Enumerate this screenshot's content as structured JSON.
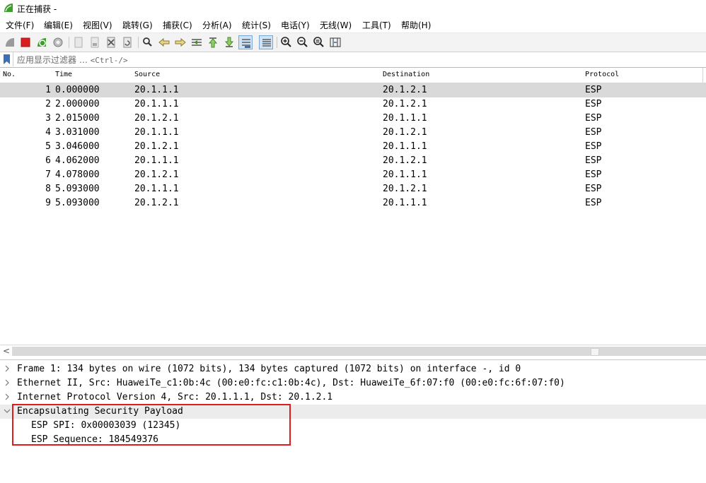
{
  "window": {
    "title": "正在捕获 -"
  },
  "menu": {
    "items": [
      {
        "label": "文件(F)"
      },
      {
        "label": "编辑(E)"
      },
      {
        "label": "视图(V)"
      },
      {
        "label": "跳转(G)"
      },
      {
        "label": "捕获(C)"
      },
      {
        "label": "分析(A)"
      },
      {
        "label": "统计(S)"
      },
      {
        "label": "电话(Y)"
      },
      {
        "label": "无线(W)"
      },
      {
        "label": "工具(T)"
      },
      {
        "label": "帮助(H)"
      }
    ]
  },
  "toolbar": {
    "buttons": [
      "start-capture-icon",
      "stop-capture-icon",
      "restart-capture-icon",
      "capture-options-icon",
      "open-file-icon",
      "save-file-icon",
      "close-file-icon",
      "reload-file-icon",
      "find-packet-icon",
      "go-back-icon",
      "go-forward-icon",
      "go-to-packet-icon",
      "go-first-icon",
      "go-last-icon",
      "autoscroll-icon",
      "colorize-icon",
      "zoom-in-icon",
      "zoom-out-icon",
      "zoom-normal-icon",
      "resize-columns-icon"
    ]
  },
  "filter": {
    "placeholder": "应用显示过滤器 …",
    "shortcut": "<Ctrl-/>"
  },
  "packet_list": {
    "columns": [
      "No.",
      "Time",
      "Source",
      "Destination",
      "Protocol"
    ],
    "rows": [
      {
        "no": "1",
        "time": "0.000000",
        "source": "20.1.1.1",
        "destination": "20.1.2.1",
        "protocol": "ESP"
      },
      {
        "no": "2",
        "time": "2.000000",
        "source": "20.1.1.1",
        "destination": "20.1.2.1",
        "protocol": "ESP"
      },
      {
        "no": "3",
        "time": "2.015000",
        "source": "20.1.2.1",
        "destination": "20.1.1.1",
        "protocol": "ESP"
      },
      {
        "no": "4",
        "time": "3.031000",
        "source": "20.1.1.1",
        "destination": "20.1.2.1",
        "protocol": "ESP"
      },
      {
        "no": "5",
        "time": "3.046000",
        "source": "20.1.2.1",
        "destination": "20.1.1.1",
        "protocol": "ESP"
      },
      {
        "no": "6",
        "time": "4.062000",
        "source": "20.1.1.1",
        "destination": "20.1.2.1",
        "protocol": "ESP"
      },
      {
        "no": "7",
        "time": "4.078000",
        "source": "20.1.2.1",
        "destination": "20.1.1.1",
        "protocol": "ESP"
      },
      {
        "no": "8",
        "time": "5.093000",
        "source": "20.1.1.1",
        "destination": "20.1.2.1",
        "protocol": "ESP"
      },
      {
        "no": "9",
        "time": "5.093000",
        "source": "20.1.2.1",
        "destination": "20.1.1.1",
        "protocol": "ESP"
      }
    ],
    "selected_row": 1
  },
  "details": {
    "frame": "Frame 1: 134 bytes on wire (1072 bits), 134 bytes captured (1072 bits) on interface -, id 0",
    "ethernet": "Ethernet II, Src: HuaweiTe_c1:0b:4c (00:e0:fc:c1:0b:4c), Dst: HuaweiTe_6f:07:f0 (00:e0:fc:6f:07:f0)",
    "ip": "Internet Protocol Version 4, Src: 20.1.1.1, Dst: 20.1.2.1",
    "esp": "Encapsulating Security Payload",
    "esp_spi": "ESP SPI: 0x00003039 (12345)",
    "esp_seq": "ESP Sequence: 184549376"
  },
  "colors": {
    "selected_row": "#d9d9d9",
    "highlight_box": "#e01b1b",
    "app_icon": "#3aa02a"
  }
}
